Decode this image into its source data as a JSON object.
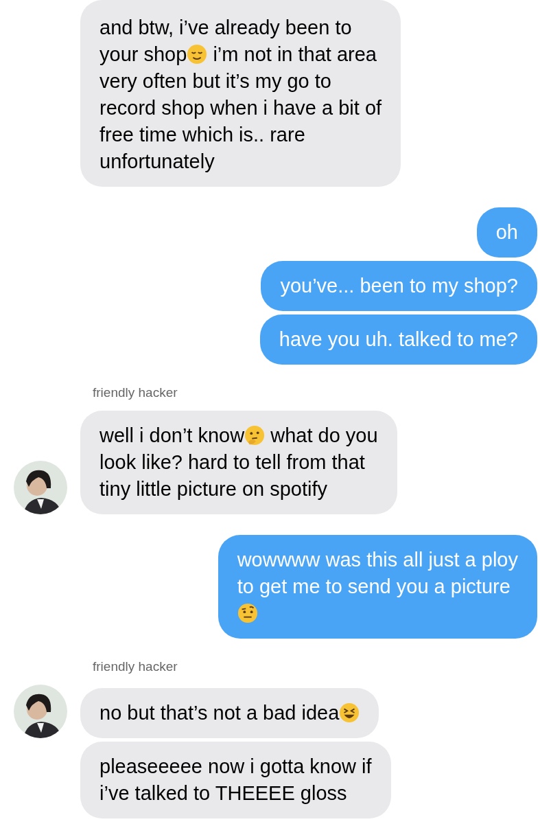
{
  "groups": [
    {
      "outgoing": false,
      "avatar": false,
      "messages": [
        {
          "lines": [
            [
              {
                "kind": "text",
                "text": "and btw, i’ve already been to"
              }
            ],
            [
              {
                "kind": "text",
                "text": "your shop"
              },
              {
                "kind": "emoji-relieved"
              },
              {
                "kind": "text",
                "text": " i’m not in that area"
              }
            ],
            [
              {
                "kind": "text",
                "text": "very often but it’s my go to"
              }
            ],
            [
              {
                "kind": "text",
                "text": "record shop when i have a bit of"
              }
            ],
            [
              {
                "kind": "text",
                "text": "free time which is.. rare"
              }
            ],
            [
              {
                "kind": "text",
                "text": "unfortunately"
              }
            ]
          ]
        }
      ]
    },
    {
      "outgoing": true,
      "messages": [
        {
          "lines": [
            [
              {
                "kind": "text",
                "text": "oh"
              }
            ]
          ]
        },
        {
          "lines": [
            [
              {
                "kind": "text",
                "text": "you’ve... been to my shop?"
              }
            ]
          ]
        },
        {
          "lines": [
            [
              {
                "kind": "text",
                "text": "have you uh. talked to me?"
              }
            ]
          ]
        }
      ]
    },
    {
      "outgoing": false,
      "sender": "friendly hacker",
      "avatar": true,
      "messages": [
        {
          "lines": [
            [
              {
                "kind": "text",
                "text": "well i don’t know"
              },
              {
                "kind": "emoji-thinking"
              },
              {
                "kind": "text",
                "text": " what do you"
              }
            ],
            [
              {
                "kind": "text",
                "text": "look like? hard to tell from that"
              }
            ],
            [
              {
                "kind": "text",
                "text": "tiny little picture on spotify"
              }
            ]
          ]
        }
      ]
    },
    {
      "outgoing": true,
      "messages": [
        {
          "lines": [
            [
              {
                "kind": "text",
                "text": "wowwww was this all just a ploy"
              }
            ],
            [
              {
                "kind": "text",
                "text": "to get me to send you a picture"
              }
            ],
            [
              {
                "kind": "emoji-raised-eyebrow"
              }
            ]
          ]
        }
      ]
    },
    {
      "outgoing": false,
      "sender": "friendly hacker",
      "avatar": true,
      "messages": [
        {
          "lines": [
            [
              {
                "kind": "text",
                "text": "no but that’s not a bad idea"
              },
              {
                "kind": "emoji-laughing"
              }
            ]
          ]
        },
        {
          "lines": [
            [
              {
                "kind": "text",
                "text": "pleaseeeee now i gotta know if"
              }
            ],
            [
              {
                "kind": "text",
                "text": "i’ve talked to THEEEE gloss"
              }
            ]
          ]
        }
      ]
    }
  ]
}
